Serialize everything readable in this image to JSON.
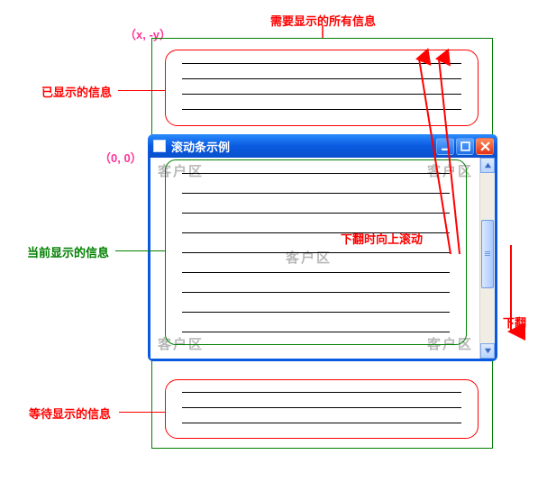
{
  "labels": {
    "coord_origin_offset": "（x, -y）",
    "coord_origin": "（0, 0）",
    "all_info": "需要显示的所有信息",
    "already_shown": "已显示的信息",
    "currently_shown": "当前显示的信息",
    "waiting_shown": "等待显示的信息",
    "scroll_up_on_page_down": "下翻时向上滚动",
    "page_down": "下翻",
    "client_area": "客户区"
  },
  "window": {
    "title": "滚动条示例",
    "buttons": {
      "min": "minimize",
      "max": "maximize",
      "close": "close"
    }
  },
  "colors": {
    "red": "#ff0000",
    "green": "#008000",
    "xp_blue": "#0a5ae0",
    "scrollbar_face": "#b8d4ff"
  },
  "diagram": {
    "line_groups": {
      "already_shown_lines": 4,
      "currently_shown_lines": 9,
      "waiting_shown_lines": 3
    },
    "arrows": [
      {
        "name": "scroll-content-up",
        "color": "red",
        "from": "viewport-bottom",
        "to": "above-viewport"
      },
      {
        "name": "page-down",
        "color": "red",
        "from": "scrollbar-thumb",
        "to": "scrollbar-down-button"
      }
    ]
  }
}
